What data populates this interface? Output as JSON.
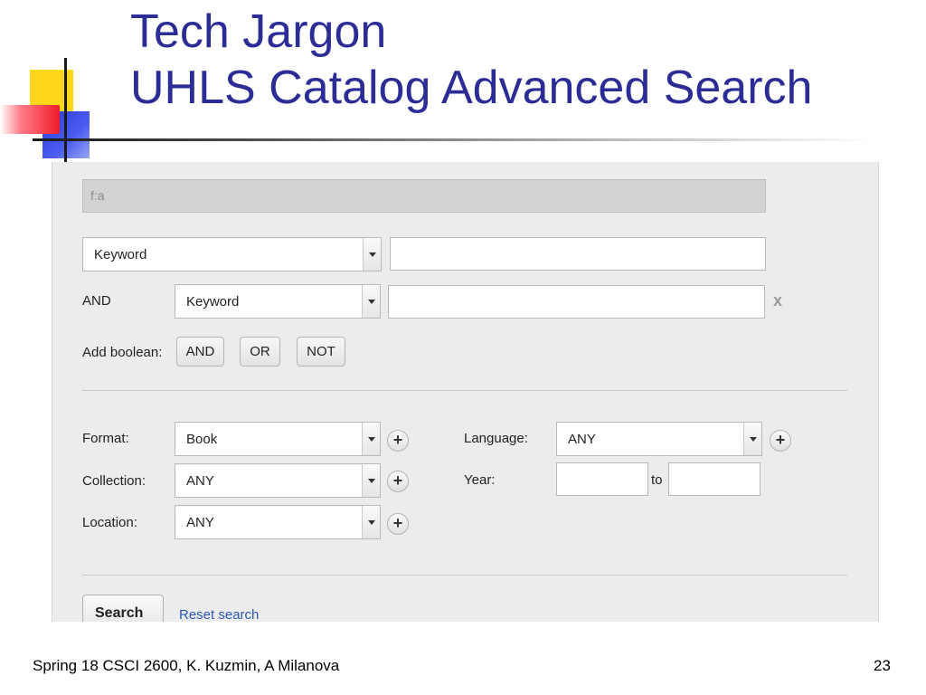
{
  "slide": {
    "title_line1": "Tech Jargon",
    "title_line2": "UHLS Catalog Advanced Search",
    "footer_left": "Spring 18 CSCI 2600, K. Kuzmin, A Milanova",
    "page_number": "23"
  },
  "search_form": {
    "query_text": "f:a",
    "row1": {
      "field_select": "Keyword",
      "term_value": ""
    },
    "row2": {
      "operator": "AND",
      "field_select": "Keyword",
      "term_value": "",
      "remove_symbol": "x"
    },
    "add_boolean": {
      "label": "Add boolean:",
      "buttons": [
        "AND",
        "OR",
        "NOT"
      ]
    },
    "filters": {
      "format": {
        "label": "Format:",
        "value": "Book"
      },
      "collection": {
        "label": "Collection:",
        "value": "ANY"
      },
      "location": {
        "label": "Location:",
        "value": "ANY"
      },
      "language": {
        "label": "Language:",
        "value": "ANY"
      },
      "year": {
        "label": "Year:",
        "from": "",
        "to_label": "to",
        "to": ""
      }
    },
    "plus_symbol": "+",
    "search_button": "Search",
    "reset_link": "Reset search"
  },
  "colors": {
    "title": "#2b2c95",
    "link": "#2a58b0",
    "panel_bg": "#ececec",
    "deco_yellow": "#ffd71a",
    "deco_blue": "#2a3bd6",
    "deco_red": "#f01c2c"
  }
}
